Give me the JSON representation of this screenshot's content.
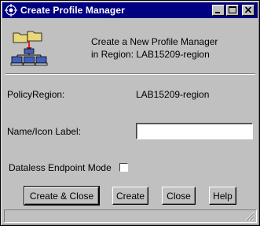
{
  "window": {
    "title": "Create Profile Manager"
  },
  "header": {
    "line1": "Create a New Profile Manager",
    "line2": "in Region: LAB15209-region"
  },
  "form": {
    "policy_region_label": "PolicyRegion:",
    "policy_region_value": "LAB15209-region",
    "name_label": "Name/Icon Label:",
    "name_value": "",
    "dataless_label": "Dataless Endpoint Mode",
    "dataless_checked": false
  },
  "buttons": {
    "create_close": "Create & Close",
    "create": "Create",
    "close": "Close",
    "help": "Help"
  },
  "status": {
    "text": ""
  },
  "colors": {
    "titlebar": "#000080",
    "face": "#c0c0c0"
  },
  "icons": {
    "title": "tivoli-app-icon",
    "header": "profile-manager-icon",
    "minimize": "minimize-icon",
    "maximize": "maximize-icon",
    "close": "close-icon"
  }
}
